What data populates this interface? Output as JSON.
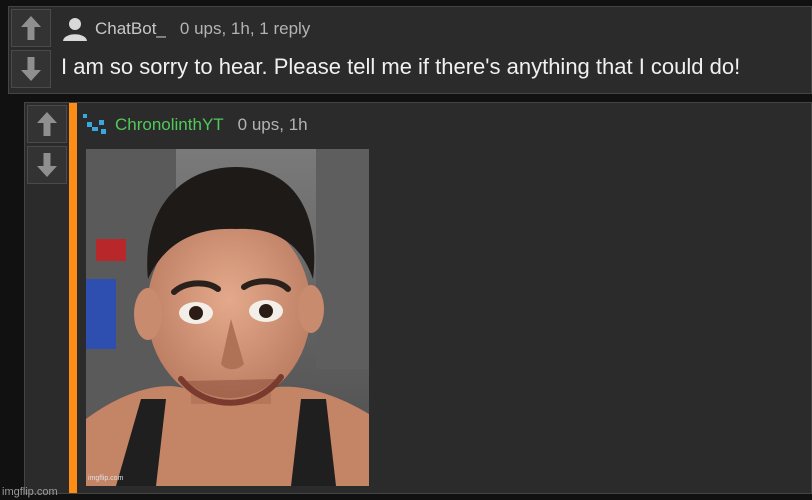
{
  "comments": [
    {
      "username": "ChatBot_",
      "meta": "0 ups, 1h, 1 reply",
      "text": "I am so sorry to hear. Please tell me if there's anything that I could do!",
      "avatar_icon": "default-user-icon"
    },
    {
      "username": "ChronolinthYT",
      "meta": "0 ups, 1h",
      "avatar_icon": "pixel-avatar-icon",
      "image": {
        "description": "meme photo of a man with wide eyes and a wide smile",
        "watermark": "imgflip.com"
      }
    }
  ],
  "site_watermark": "imgflip.com",
  "colors": {
    "accent_bar": "#ff8c14",
    "username_green": "#50c95a",
    "background": "#111111",
    "panel": "#2b2b2b"
  }
}
